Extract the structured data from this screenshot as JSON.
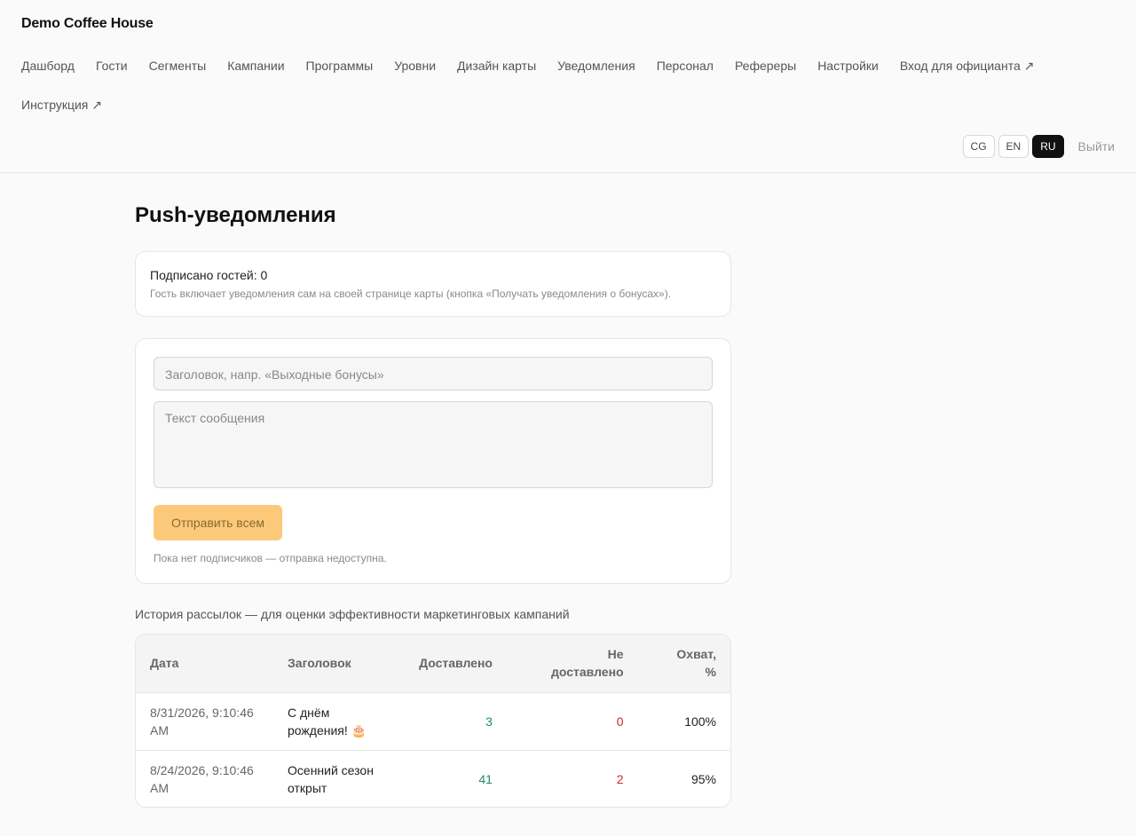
{
  "brand": "Demo Coffee House",
  "nav": {
    "row1": [
      "Дашборд",
      "Гости",
      "Сегменты",
      "Кампании",
      "Программы",
      "Уровни",
      "Дизайн карты",
      "Уведомления",
      "Персонал",
      "Рефереры",
      "Настройки",
      "Вход для официанта ↗"
    ],
    "row2": [
      "Инструкция ↗"
    ]
  },
  "languages": [
    "CG",
    "EN",
    "RU"
  ],
  "active_language": "RU",
  "logout_label": "Выйти",
  "page_title": "Push-уведомления",
  "subscribers": {
    "line": "Подписано гостей: 0",
    "hint": "Гость включает уведомления сам на своей странице карты (кнопка «Получать уведомления о бонусах»)."
  },
  "form": {
    "title_placeholder": "Заголовок, напр. «Выходные бонусы»",
    "body_placeholder": "Текст сообщения",
    "send_label": "Отправить всем",
    "hint": "Пока нет подписчиков — отправка недоступна."
  },
  "history": {
    "title": "История рассылок — для оценки эффективности маркетинговых кампаний",
    "columns": [
      "Дата",
      "Заголовок",
      "Доставлено",
      "Не доставлено",
      "Охват, %"
    ],
    "rows": [
      {
        "date": "8/31/2026, 9:10:46 AM",
        "title": "С днём рождения! 🎂",
        "delivered": "3",
        "failed": "0",
        "reach": "100%"
      },
      {
        "date": "8/24/2026, 9:10:46 AM",
        "title": "Осенний сезон открыт",
        "delivered": "41",
        "failed": "2",
        "reach": "95%"
      }
    ]
  }
}
